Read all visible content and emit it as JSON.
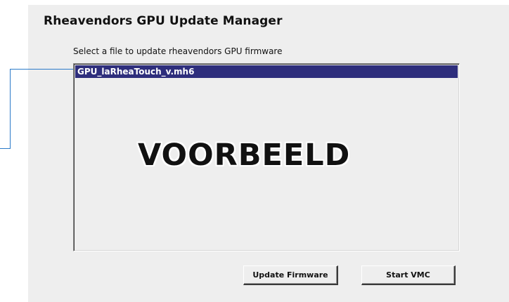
{
  "window": {
    "title": "Rheavendors GPU Update Manager",
    "subtitle": "Select a file to update rheavendors GPU firmware"
  },
  "file_list": {
    "items": [
      {
        "label": "GPU_laRheaTouch_v.mh6",
        "selected": true
      }
    ]
  },
  "watermark": "VOORBEELD",
  "buttons": {
    "update_firmware": "Update Firmware",
    "start_vmc": "Start VMC"
  },
  "colors": {
    "window_bg": "#eeeeee",
    "selection_bg": "#2e2e7c",
    "selection_text": "#ffffff",
    "callout_line": "#2a7ac9"
  }
}
